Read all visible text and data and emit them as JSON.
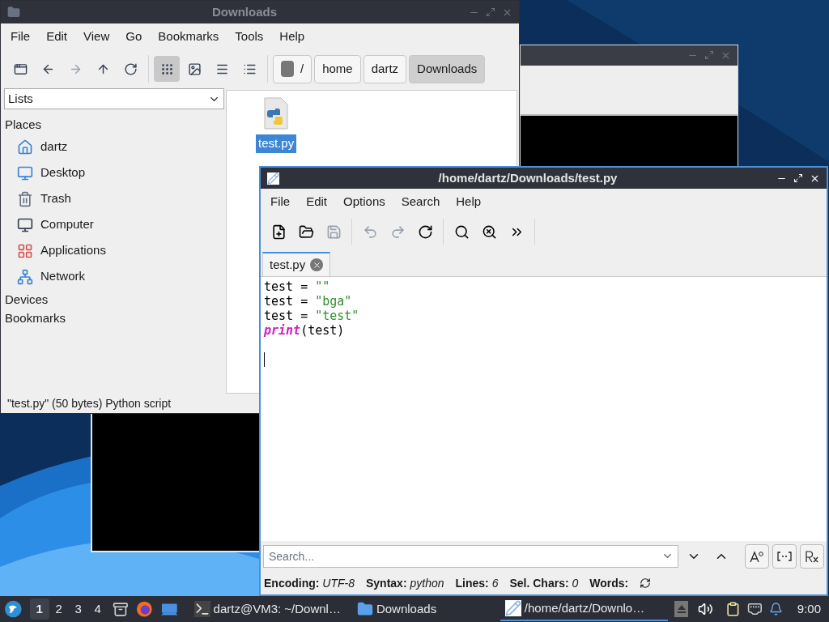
{
  "file_manager": {
    "title": "Downloads",
    "menu": [
      "File",
      "Edit",
      "View",
      "Go",
      "Bookmarks",
      "Tools",
      "Help"
    ],
    "nav": [
      {
        "kind": "new-window",
        "disabled": false
      },
      {
        "kind": "back",
        "disabled": false
      },
      {
        "kind": "forward",
        "disabled": true
      },
      {
        "kind": "up",
        "disabled": false
      },
      {
        "kind": "reload",
        "disabled": false
      }
    ],
    "view_modes": [
      {
        "kind": "icons",
        "selected": true
      },
      {
        "kind": "thumbnails",
        "selected": false
      },
      {
        "kind": "compact",
        "selected": false
      },
      {
        "kind": "details",
        "selected": false
      }
    ],
    "path": [
      {
        "label": "/",
        "kind": "root",
        "selected": false
      },
      {
        "label": "home",
        "kind": "dir",
        "selected": false
      },
      {
        "label": "dartz",
        "kind": "dir",
        "selected": false
      },
      {
        "label": "Downloads",
        "kind": "dir",
        "selected": true
      }
    ],
    "side_pane": {
      "mode": "Lists",
      "places_heading": "Places",
      "places": [
        {
          "label": "dartz",
          "kind": "home"
        },
        {
          "label": "Desktop",
          "kind": "desktop"
        },
        {
          "label": "Trash",
          "kind": "trash"
        },
        {
          "label": "Computer",
          "kind": "computer"
        },
        {
          "label": "Applications",
          "kind": "apps"
        },
        {
          "label": "Network",
          "kind": "network"
        }
      ],
      "sections": [
        "Devices",
        "Bookmarks"
      ]
    },
    "files": [
      {
        "name": "test.py",
        "selected": true
      }
    ],
    "status": "\"test.py\" (50 bytes) Python script"
  },
  "editor": {
    "title": "/home/dartz/Downloads/test.py",
    "menu": [
      "File",
      "Edit",
      "Options",
      "Search",
      "Help"
    ],
    "toolbar": [
      {
        "kind": "new",
        "disabled": false
      },
      {
        "kind": "open",
        "disabled": false
      },
      {
        "kind": "save",
        "disabled": true
      },
      {
        "kind": "sep"
      },
      {
        "kind": "undo",
        "disabled": true
      },
      {
        "kind": "redo",
        "disabled": true
      },
      {
        "kind": "reload",
        "disabled": false
      },
      {
        "kind": "sep"
      },
      {
        "kind": "find",
        "disabled": false
      },
      {
        "kind": "replace",
        "disabled": false
      },
      {
        "kind": "more",
        "disabled": false
      },
      {
        "kind": "sep"
      }
    ],
    "tabs": [
      {
        "label": "test.py",
        "selected": true
      }
    ],
    "code": [
      [
        {
          "kind": "plain",
          "text": "test = "
        },
        {
          "kind": "string",
          "text": "\"\""
        }
      ],
      [
        {
          "kind": "plain",
          "text": "test = "
        },
        {
          "kind": "string",
          "text": "\"bga\""
        }
      ],
      [
        {
          "kind": "plain",
          "text": "test = "
        },
        {
          "kind": "string",
          "text": "\"test\""
        }
      ],
      [
        {
          "kind": "keyword",
          "text": "print"
        },
        {
          "kind": "plain",
          "text": "(test)"
        }
      ]
    ],
    "search": {
      "placeholder": "Search..."
    },
    "search_options": [
      {
        "kind": "case",
        "selected": false
      },
      {
        "kind": "whole",
        "selected": false
      },
      {
        "kind": "regex",
        "selected": false
      }
    ],
    "status": [
      {
        "label": "Encoding:",
        "value": "UTF-8"
      },
      {
        "label": "Syntax:",
        "value": "python"
      },
      {
        "label": "Lines:",
        "value": "6"
      },
      {
        "label": "Sel. Chars:",
        "value": "0"
      },
      {
        "label": "Words:"
      }
    ]
  },
  "taskbar": {
    "workspaces": [
      {
        "label": "1",
        "selected": true
      },
      {
        "label": "2",
        "selected": false
      },
      {
        "label": "3",
        "selected": false
      },
      {
        "label": "4",
        "selected": false
      }
    ],
    "tasks": [
      {
        "label": "dartz@VM3: ~/Downl…",
        "kind": "terminal",
        "selected": false
      },
      {
        "label": "Downloads",
        "kind": "folder",
        "selected": false
      },
      {
        "label": "/home/dartz/Downlo…",
        "kind": "editor",
        "selected": true
      }
    ],
    "clock": "9:00"
  }
}
